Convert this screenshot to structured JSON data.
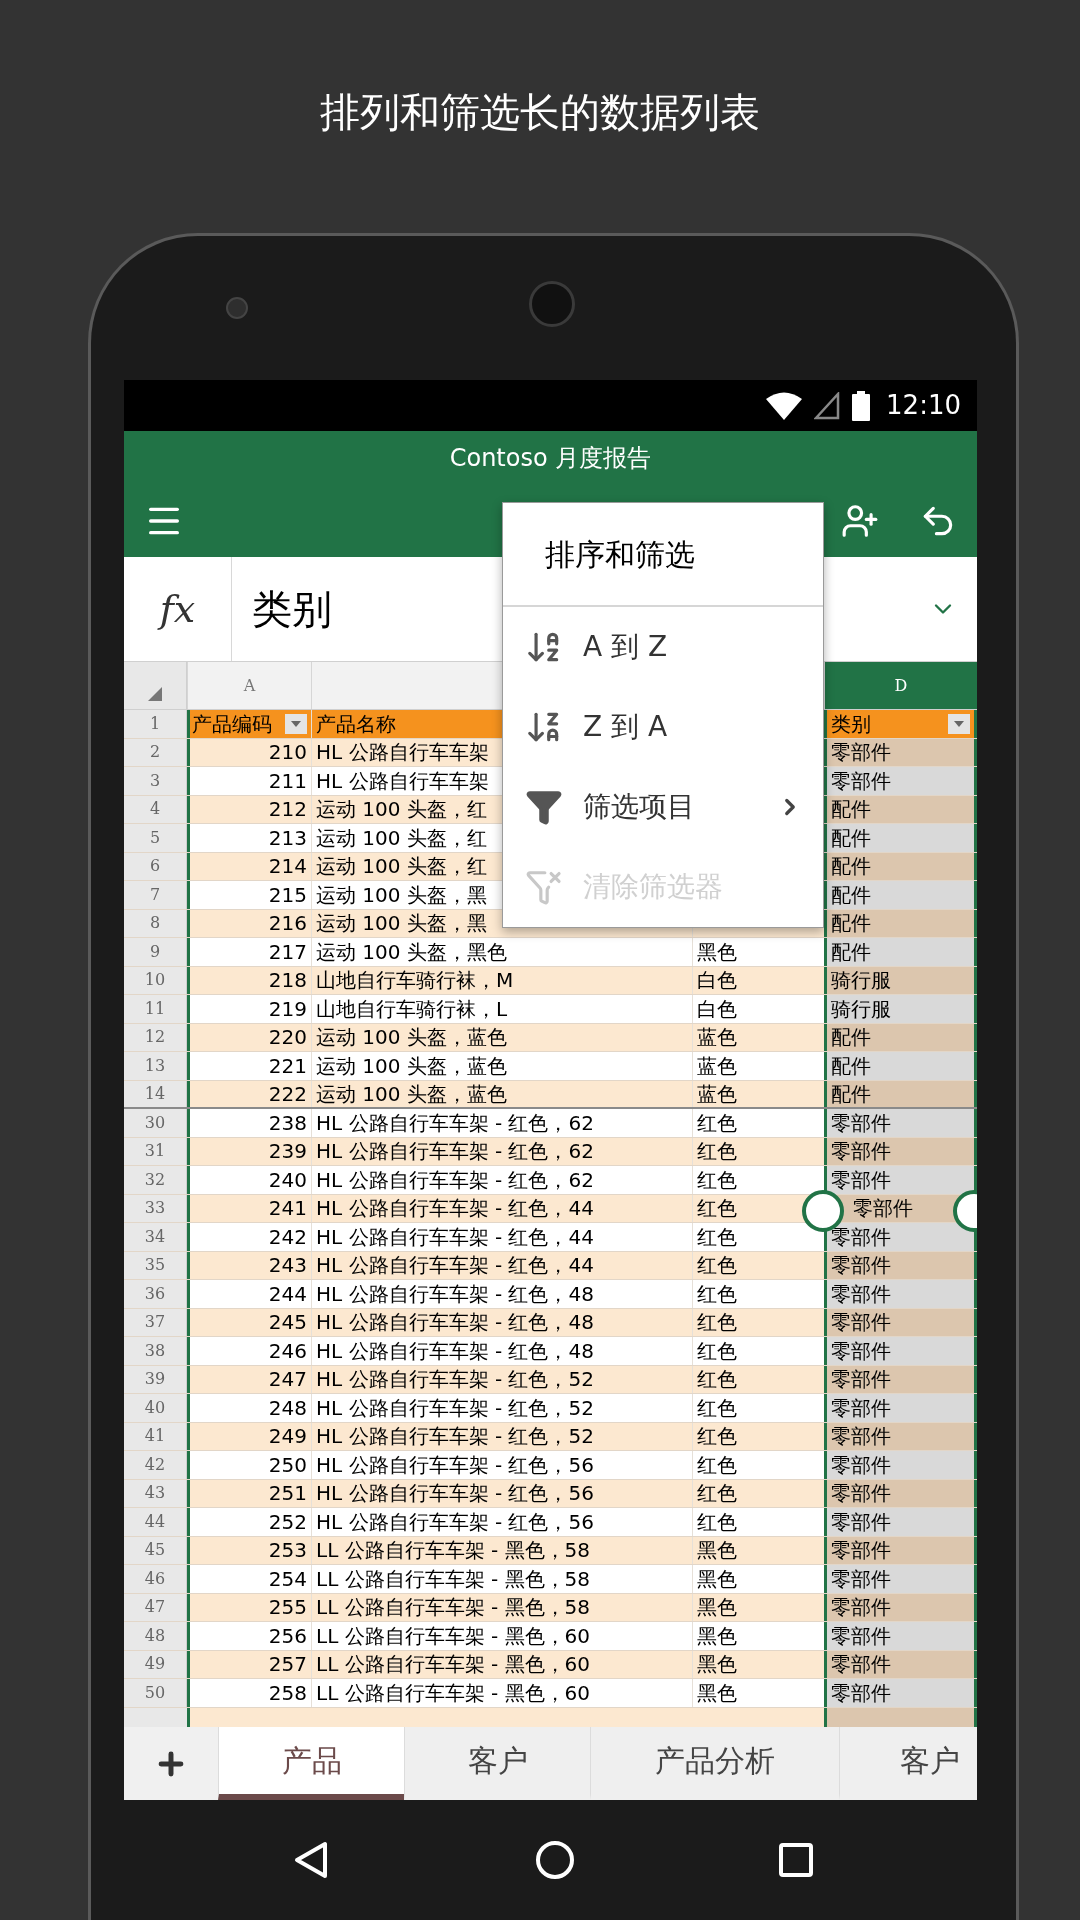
{
  "headline": "排列和筛选长的数据列表",
  "status_bar": {
    "time": "12:10"
  },
  "app": {
    "title": "Contoso 月度报告"
  },
  "formula_bar": {
    "fx": "fx",
    "value": "类别"
  },
  "columns": [
    {
      "letter": "A",
      "selected": false
    },
    {
      "letter": "D",
      "selected": true
    }
  ],
  "header_row": {
    "row": "1",
    "a": "产品编码",
    "b": "产品名称",
    "d": "类别"
  },
  "rows": [
    {
      "row": "2",
      "a": "210",
      "b": "HL 公路自行车车架",
      "d": "零部件"
    },
    {
      "row": "3",
      "a": "211",
      "b": "HL 公路自行车车架",
      "d": "零部件"
    },
    {
      "row": "4",
      "a": "212",
      "b": "运动 100 头盔，红",
      "d": "配件"
    },
    {
      "row": "5",
      "a": "213",
      "b": "运动 100 头盔，红",
      "d": "配件"
    },
    {
      "row": "6",
      "a": "214",
      "b": "运动 100 头盔，红",
      "d": "配件"
    },
    {
      "row": "7",
      "a": "215",
      "b": "运动 100 头盔，黑",
      "d": "配件"
    },
    {
      "row": "8",
      "a": "216",
      "b": "运动 100 头盔，黑",
      "d": "配件"
    },
    {
      "row": "9",
      "a": "217",
      "b": "运动 100 头盔，黑色",
      "c": "黑色",
      "d": "配件"
    },
    {
      "row": "10",
      "a": "218",
      "b": "山地自行车骑行袜，M",
      "c": "白色",
      "d": "骑行服"
    },
    {
      "row": "11",
      "a": "219",
      "b": "山地自行车骑行袜，L",
      "c": "白色",
      "d": "骑行服"
    },
    {
      "row": "12",
      "a": "220",
      "b": "运动 100 头盔，蓝色",
      "c": "蓝色",
      "d": "配件"
    },
    {
      "row": "13",
      "a": "221",
      "b": "运动 100 头盔，蓝色",
      "c": "蓝色",
      "d": "配件"
    },
    {
      "row": "14",
      "a": "222",
      "b": "运动 100 头盔，蓝色",
      "c": "蓝色",
      "d": "配件"
    },
    {
      "row": "30",
      "a": "238",
      "b": "HL 公路自行车车架 - 红色，62",
      "c": "红色",
      "d": "零部件"
    },
    {
      "row": "31",
      "a": "239",
      "b": "HL 公路自行车车架 - 红色，62",
      "c": "红色",
      "d": "零部件"
    },
    {
      "row": "32",
      "a": "240",
      "b": "HL 公路自行车车架 - 红色，62",
      "c": "红色",
      "d": "零部件"
    },
    {
      "row": "33",
      "a": "241",
      "b": "HL 公路自行车车架 - 红色，44",
      "c": "红色",
      "d": "零部件"
    },
    {
      "row": "34",
      "a": "242",
      "b": "HL 公路自行车车架 - 红色，44",
      "c": "红色",
      "d": "零部件"
    },
    {
      "row": "35",
      "a": "243",
      "b": "HL 公路自行车车架 - 红色，44",
      "c": "红色",
      "d": "零部件"
    },
    {
      "row": "36",
      "a": "244",
      "b": "HL 公路自行车车架 - 红色，48",
      "c": "红色",
      "d": "零部件"
    },
    {
      "row": "37",
      "a": "245",
      "b": "HL 公路自行车车架 - 红色，48",
      "c": "红色",
      "d": "零部件"
    },
    {
      "row": "38",
      "a": "246",
      "b": "HL 公路自行车车架 - 红色，48",
      "c": "红色",
      "d": "零部件"
    },
    {
      "row": "39",
      "a": "247",
      "b": "HL 公路自行车车架 - 红色，52",
      "c": "红色",
      "d": "零部件"
    },
    {
      "row": "40",
      "a": "248",
      "b": "HL 公路自行车车架 - 红色，52",
      "c": "红色",
      "d": "零部件"
    },
    {
      "row": "41",
      "a": "249",
      "b": "HL 公路自行车车架 - 红色，52",
      "c": "红色",
      "d": "零部件"
    },
    {
      "row": "42",
      "a": "250",
      "b": "HL 公路自行车车架 - 红色，56",
      "c": "红色",
      "d": "零部件"
    },
    {
      "row": "43",
      "a": "251",
      "b": "HL 公路自行车车架 - 红色，56",
      "c": "红色",
      "d": "零部件"
    },
    {
      "row": "44",
      "a": "252",
      "b": "HL 公路自行车车架 - 红色，56",
      "c": "红色",
      "d": "零部件"
    },
    {
      "row": "45",
      "a": "253",
      "b": "LL 公路自行车车架 - 黑色，58",
      "c": "黑色",
      "d": "零部件"
    },
    {
      "row": "46",
      "a": "254",
      "b": "LL 公路自行车车架 - 黑色，58",
      "c": "黑色",
      "d": "零部件"
    },
    {
      "row": "47",
      "a": "255",
      "b": "LL 公路自行车车架 - 黑色，58",
      "c": "黑色",
      "d": "零部件"
    },
    {
      "row": "48",
      "a": "256",
      "b": "LL 公路自行车车架 - 黑色，60",
      "c": "黑色",
      "d": "零部件"
    },
    {
      "row": "49",
      "a": "257",
      "b": "LL 公路自行车车架 - 黑色，60",
      "c": "黑色",
      "d": "零部件"
    },
    {
      "row": "50",
      "a": "258",
      "b": "LL 公路自行车车架 - 黑色，60",
      "c": "黑色",
      "d": "零部件"
    }
  ],
  "menu": {
    "title": "排序和筛选",
    "items": [
      {
        "kind": "sort-asc",
        "label": "A 到 Z",
        "disabled": false,
        "submenu": false
      },
      {
        "kind": "sort-desc",
        "label": "Z 到 A",
        "disabled": false,
        "submenu": false
      },
      {
        "kind": "filter",
        "label": "筛选项目",
        "disabled": false,
        "submenu": true
      },
      {
        "kind": "clear-filter",
        "label": "清除筛选器",
        "disabled": true,
        "submenu": false
      }
    ]
  },
  "sheet_tabs": [
    {
      "label": "产品",
      "selected": true
    },
    {
      "label": "客户",
      "selected": false
    },
    {
      "label": "产品分析",
      "selected": false
    },
    {
      "label": "客户",
      "selected": false
    }
  ]
}
